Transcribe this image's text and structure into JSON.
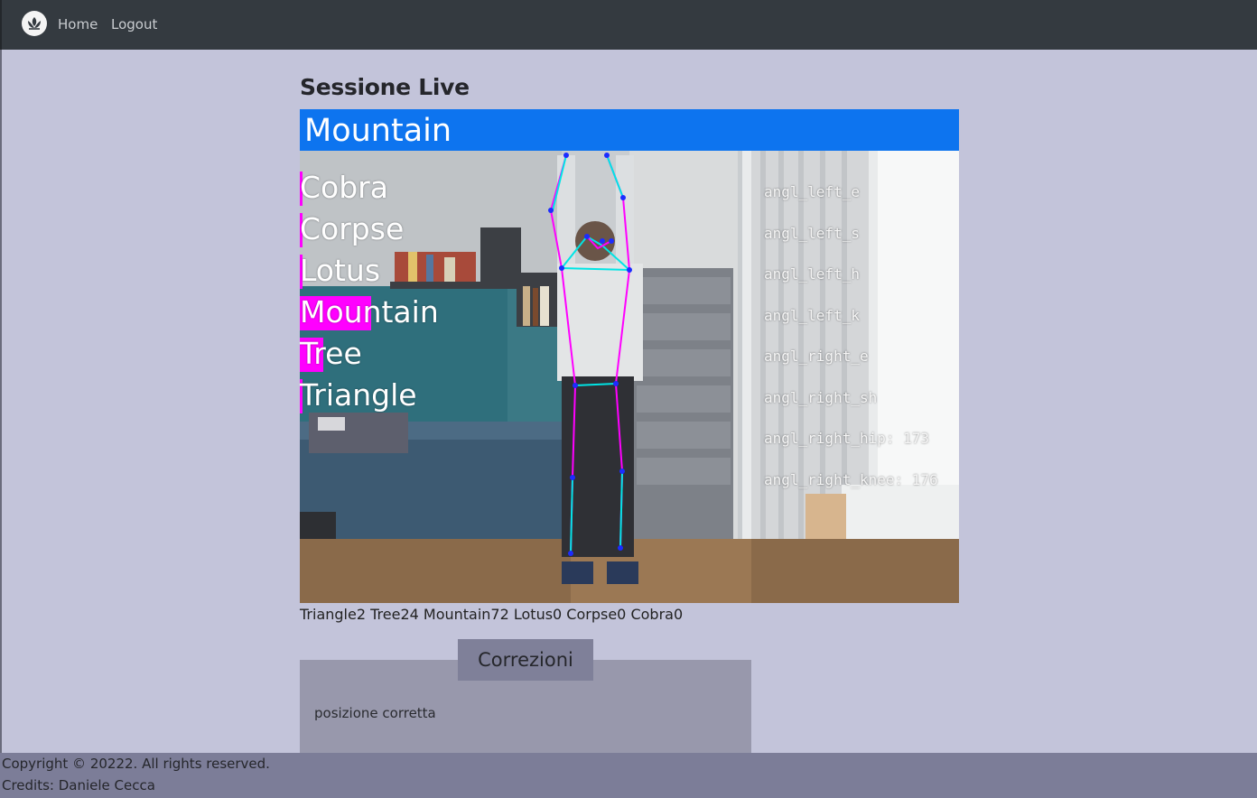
{
  "navbar": {
    "logo_icon": "lotus-logo-icon",
    "links": [
      "Home",
      "Logout"
    ]
  },
  "page": {
    "title": "Sessione Live"
  },
  "video": {
    "current_pose": "Mountain",
    "header_color": "#0d74ef",
    "highlight_color": "#ff00ff",
    "poses": [
      {
        "name": "Cobra",
        "confidence": 0.0
      },
      {
        "name": "Corpse",
        "confidence": 0.0
      },
      {
        "name": "Lotus",
        "confidence": 0.0
      },
      {
        "name": "Mountain",
        "confidence": 0.72
      },
      {
        "name": "Tree",
        "confidence": 0.24
      },
      {
        "name": "Triangle",
        "confidence": 0.02
      }
    ],
    "angles": [
      "angl_left_e",
      "angl_left_s",
      "angl_left_h",
      "angl_left_k",
      "angl_right_e",
      "angl_right_sh",
      "angl_right_hip: 173",
      "angl_right_knee: 176"
    ]
  },
  "scores_text": "Triangle2 Tree24 Mountain72 Lotus0 Corpse0 Cobra0",
  "corrections": {
    "tab_label": "Correzioni",
    "message": "posizione corretta"
  },
  "footer": {
    "copyright": "Copyright © 20222. All rights reserved.",
    "credits": "Credits: Daniele Cecca"
  }
}
